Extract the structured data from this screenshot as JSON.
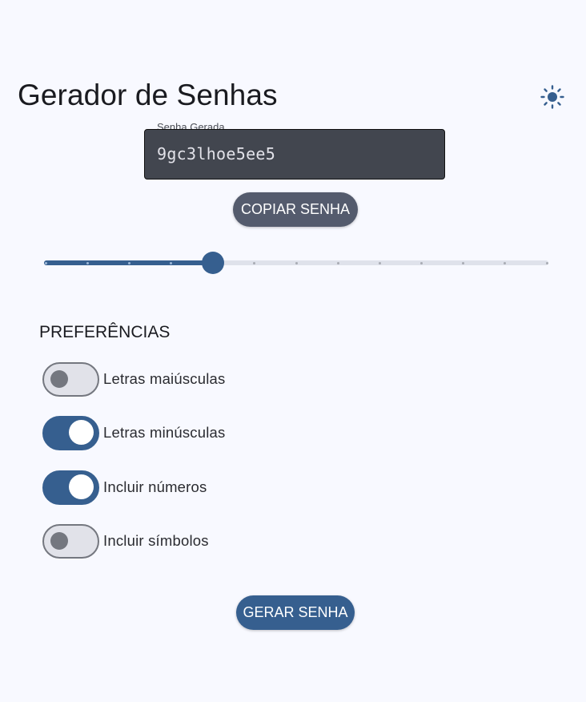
{
  "header": {
    "title": "Gerador de Senhas",
    "theme_icon": "sun-icon"
  },
  "password_field": {
    "label": "Senha Gerada",
    "value": "9gc3lhoe5ee5"
  },
  "buttons": {
    "copy_label": "COPIAR SENHA",
    "generate_label": "GERAR SENHA"
  },
  "length_slider": {
    "min": 0,
    "max": 12,
    "steps": 12,
    "value": 4
  },
  "preferences": {
    "title": "PREFERÊNCIAS",
    "items": [
      {
        "label": "Letras maiúsculas",
        "enabled": false
      },
      {
        "label": "Letras minúsculas",
        "enabled": true
      },
      {
        "label": "Incluir números",
        "enabled": true
      },
      {
        "label": "Incluir símbolos",
        "enabled": false
      }
    ]
  },
  "colors": {
    "primary": "#365f8f",
    "secondary_button": "#545b6d",
    "background": "#f8f9ff",
    "field_background": "#42464f",
    "track_inactive": "#dfe2eb",
    "switch_off": "#74777f"
  }
}
